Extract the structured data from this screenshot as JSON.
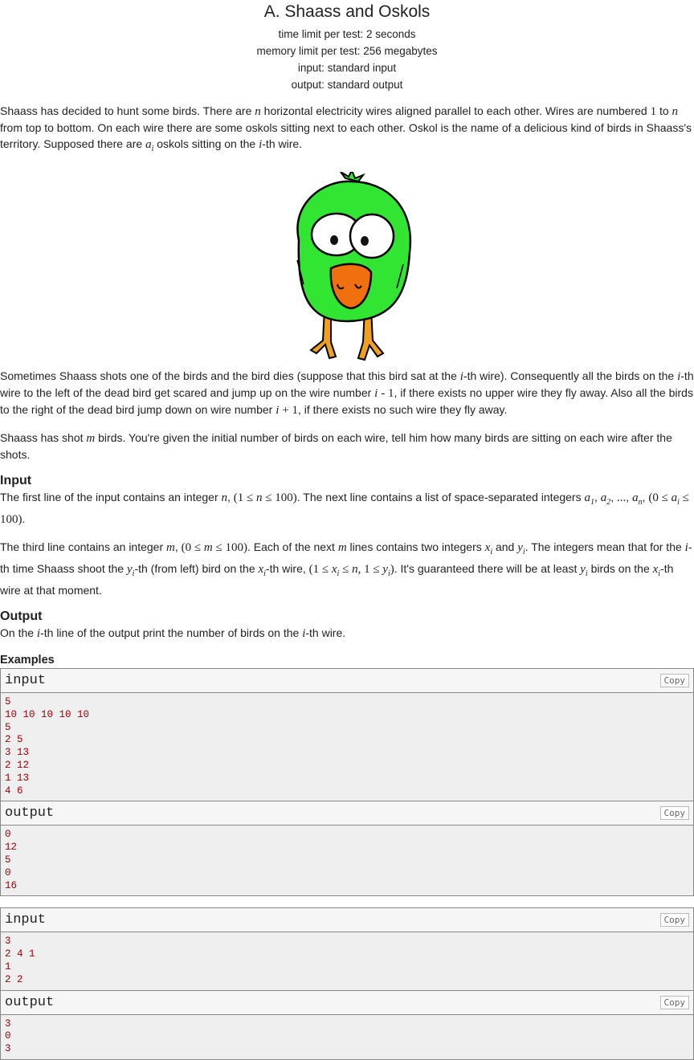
{
  "problem": {
    "title": "A. Shaass and Oskols",
    "time_limit": "time limit per test: 2 seconds",
    "memory_limit": "memory limit per test: 256 megabytes",
    "input": "input: standard input",
    "output": "output: standard output"
  },
  "sections": {
    "input_heading": "Input",
    "output_heading": "Output",
    "examples_heading": "Examples"
  },
  "examples": [
    {
      "input_label": "input",
      "input": "5\n10 10 10 10 10\n5\n2 5\n3 13\n2 12\n1 13\n4 6",
      "output_label": "output",
      "output": "0\n12\n5\n0\n16"
    },
    {
      "input_label": "input",
      "input": "3\n2 4 1\n1\n2 2",
      "output_label": "output",
      "output": "3\n0\n3"
    }
  ],
  "copy_label": "Copy",
  "colors": {
    "bird_body": "#33e533",
    "beak": "#f07010",
    "feet": "#f0a020"
  }
}
